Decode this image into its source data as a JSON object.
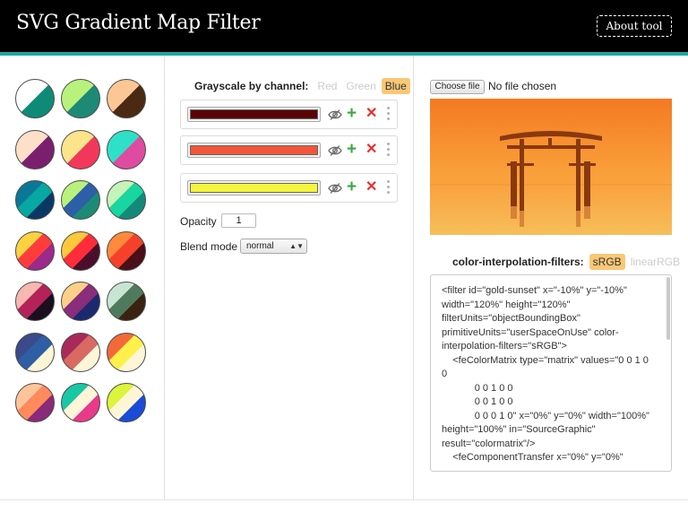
{
  "header": {
    "title": "SVG Gradient Map Filter",
    "about_label": "About tool"
  },
  "presets": [
    {
      "id": "preset-1",
      "a": "#0f8a76",
      "b": "#ffffff"
    },
    {
      "id": "preset-2",
      "a": "#1d8a76",
      "b": "#b8f27c"
    },
    {
      "id": "preset-3",
      "a": "#4a2a12",
      "b": "#fbc795"
    },
    {
      "id": "preset-4",
      "a": "#7a1f6c",
      "b": "#fde0c8"
    },
    {
      "id": "preset-5",
      "a": "#f2385a",
      "b": "#fce48a"
    },
    {
      "id": "preset-6",
      "a": "#df4ba0",
      "b": "#2fe0c8"
    },
    {
      "id": "preset-7",
      "a": "#0a3864",
      "b": "#07a7a2",
      "c": "#0b7898"
    },
    {
      "id": "preset-8",
      "a": "#1d8a76",
      "b": "#2c5fa6",
      "c": "#b8f27c"
    },
    {
      "id": "preset-9",
      "a": "#138a78",
      "b": "#18d6a0",
      "c": "#c6f4b8"
    },
    {
      "id": "preset-10",
      "a": "#9b2a8a",
      "b": "#ff3c3c",
      "c": "#fcd241"
    },
    {
      "id": "preset-11",
      "a": "#4a0f2a",
      "b": "#ff2c3c",
      "c": "#fcc83c"
    },
    {
      "id": "preset-12",
      "a": "#4a0f18",
      "b": "#f5412a",
      "c": "#ff8a3c"
    },
    {
      "id": "preset-13",
      "a": "#1a0f1f",
      "b": "#b4225a",
      "c": "#f6b8b0"
    },
    {
      "id": "preset-14",
      "a": "#1b2a6e",
      "b": "#8a2d7a",
      "c": "#fcd089"
    },
    {
      "id": "preset-15",
      "a": "#3a2210",
      "b": "#4f7a5c",
      "c": "#c8e4d2"
    },
    {
      "id": "preset-16",
      "a": "#fff6d8",
      "b": "#2e5fa4",
      "c": "#3a4a8a"
    },
    {
      "id": "preset-17",
      "a": "#fff6d8",
      "b": "#d86a62",
      "c": "#a82a5a"
    },
    {
      "id": "preset-18",
      "a": "#fff6d8",
      "b": "#fff04a",
      "c": "#f26a3a"
    },
    {
      "id": "preset-19",
      "a": "#8a2a7a",
      "b": "#ff8a5c",
      "c": "#ffc49a"
    },
    {
      "id": "preset-20",
      "a": "#e83a8a",
      "b": "#fff6d8",
      "c": "#18c8a4"
    },
    {
      "id": "preset-21",
      "a": "#1a4cd8",
      "b": "#fff6d8",
      "c": "#dcf43c"
    }
  ],
  "controls": {
    "grayscale_label": "Grayscale by channel:",
    "channels": [
      {
        "label": "Red",
        "active": false
      },
      {
        "label": "Green",
        "active": false
      },
      {
        "label": "Blue",
        "active": true
      }
    ],
    "stops": [
      {
        "color": "#5a0505"
      },
      {
        "color": "#f2553a"
      },
      {
        "color": "#f5f53c"
      }
    ],
    "opacity_label": "Opacity",
    "opacity_value": "1",
    "blend_label": "Blend mode",
    "blend_value": "normal"
  },
  "image_panel": {
    "choose_file_label": "Choose file",
    "no_file_text": "No file chosen",
    "interp_label": "color-interpolation-filters:",
    "interp_options": [
      {
        "label": "sRGB",
        "active": true
      },
      {
        "label": "linearRGB",
        "active": false
      }
    ],
    "code": "<filter id=\"gold-sunset\" x=\"-10%\" y=\"-10%\" width=\"120%\" height=\"120%\" filterUnits=\"objectBoundingBox\" primitiveUnits=\"userSpaceOnUse\" color-interpolation-filters=\"sRGB\">\n    <feColorMatrix type=\"matrix\" values=\"0 0 1 0 0\n            0 0 1 0 0\n            0 0 1 0 0\n            0 0 0 1 0\" x=\"0%\" y=\"0%\" width=\"100%\" height=\"100%\" in=\"SourceGraphic\" result=\"colormatrix\"/>\n    <feComponentTransfer x=\"0%\" y=\"0%\""
  }
}
